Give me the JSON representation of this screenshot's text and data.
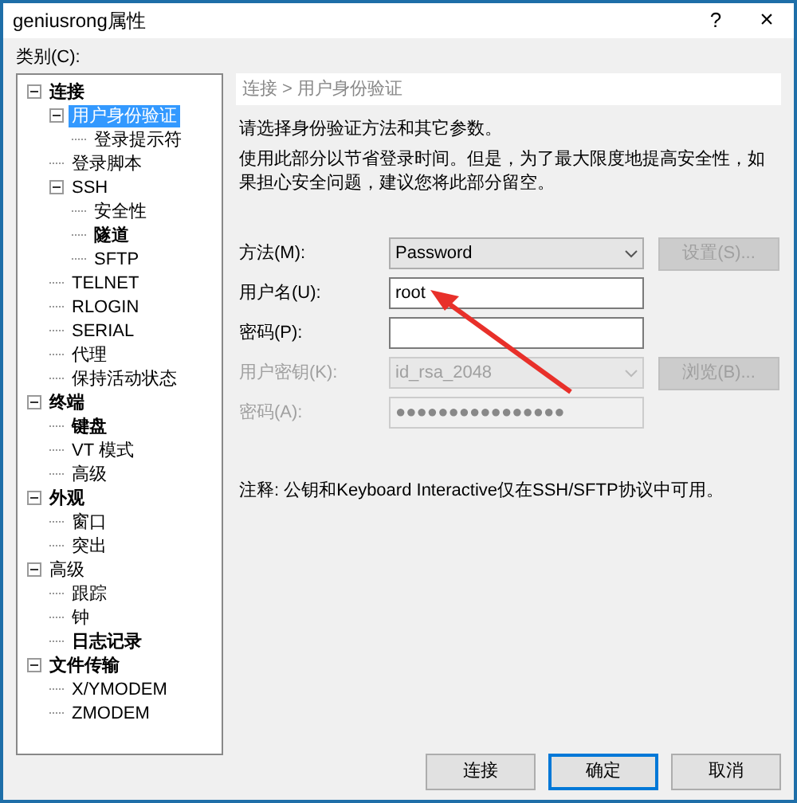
{
  "window": {
    "title": "geniusrong属性",
    "help": "?",
    "close": "×"
  },
  "category_label": "类别(C):",
  "tree": [
    {
      "label": "连接",
      "bold": true,
      "selected": false,
      "expanded": true,
      "children": [
        {
          "label": "用户身份验证",
          "bold": false,
          "selected": true,
          "expanded": true,
          "children": [
            {
              "label": "登录提示符",
              "bold": false,
              "selected": false
            }
          ]
        },
        {
          "label": "登录脚本",
          "bold": false,
          "selected": false
        },
        {
          "label": "SSH",
          "bold": false,
          "selected": false,
          "expanded": true,
          "children": [
            {
              "label": "安全性",
              "bold": false,
              "selected": false
            },
            {
              "label": "隧道",
              "bold": true,
              "selected": false
            },
            {
              "label": "SFTP",
              "bold": false,
              "selected": false
            }
          ]
        },
        {
          "label": "TELNET",
          "bold": false,
          "selected": false
        },
        {
          "label": "RLOGIN",
          "bold": false,
          "selected": false
        },
        {
          "label": "SERIAL",
          "bold": false,
          "selected": false
        },
        {
          "label": "代理",
          "bold": false,
          "selected": false
        },
        {
          "label": "保持活动状态",
          "bold": false,
          "selected": false
        }
      ]
    },
    {
      "label": "终端",
      "bold": true,
      "selected": false,
      "expanded": true,
      "children": [
        {
          "label": "键盘",
          "bold": true,
          "selected": false
        },
        {
          "label": "VT 模式",
          "bold": false,
          "selected": false
        },
        {
          "label": "高级",
          "bold": false,
          "selected": false
        }
      ]
    },
    {
      "label": "外观",
      "bold": true,
      "selected": false,
      "expanded": true,
      "children": [
        {
          "label": "窗口",
          "bold": false,
          "selected": false
        },
        {
          "label": "突出",
          "bold": false,
          "selected": false
        }
      ]
    },
    {
      "label": "高级",
      "bold": false,
      "selected": false,
      "expanded": true,
      "children": [
        {
          "label": "跟踪",
          "bold": false,
          "selected": false
        },
        {
          "label": "钟",
          "bold": false,
          "selected": false
        },
        {
          "label": "日志记录",
          "bold": true,
          "selected": false
        }
      ]
    },
    {
      "label": "文件传输",
      "bold": true,
      "selected": false,
      "expanded": true,
      "children": [
        {
          "label": "X/YMODEM",
          "bold": false,
          "selected": false
        },
        {
          "label": "ZMODEM",
          "bold": false,
          "selected": false
        }
      ]
    }
  ],
  "breadcrumb": "连接 > 用户身份验证",
  "intro": "请选择身份验证方法和其它参数。",
  "description": "使用此部分以节省登录时间。但是，为了最大限度地提高安全性，如果担心安全问题，建议您将此部分留空。",
  "form": [
    {
      "kind": "select",
      "label": "方法(M):",
      "value": "Password",
      "disabled": false,
      "button": {
        "label": "设置(S)...",
        "disabled": true
      }
    },
    {
      "kind": "text",
      "label": "用户名(U):",
      "value": "root",
      "disabled": false
    },
    {
      "kind": "text",
      "label": "密码(P):",
      "disabled": false
    },
    {
      "kind": "select",
      "label": "用户密钥(K):",
      "value": "id_rsa_2048",
      "disabled": true,
      "button": {
        "label": "浏览(B)...",
        "disabled": true
      }
    },
    {
      "kind": "text",
      "label": "密码(A):",
      "value": "●●●●●●●●●●●●●●●●",
      "disabled": true
    }
  ],
  "note": "注释: 公钥和Keyboard Interactive仅在SSH/SFTP协议中可用。",
  "buttons": [
    {
      "label": "连接",
      "default": false
    },
    {
      "label": "确定",
      "default": true
    },
    {
      "label": "取消",
      "default": false
    }
  ]
}
